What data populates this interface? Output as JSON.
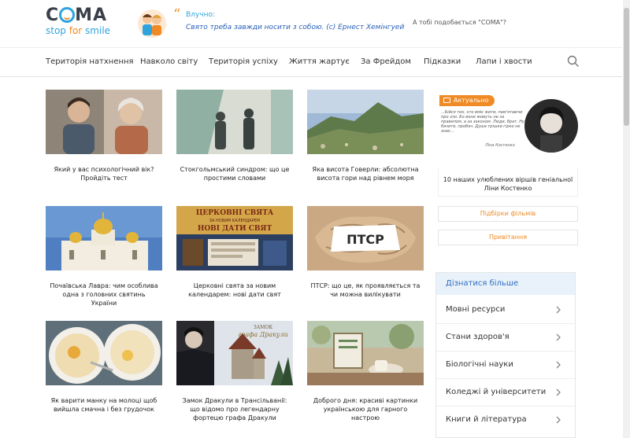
{
  "header": {
    "logo_title_pre": "C",
    "logo_title_post": "MA",
    "logo_sub_1": "stop ",
    "logo_sub_2": "for",
    "logo_sub_3": " smile",
    "quote_label": "Влучно:",
    "quote_text": "Свято треба завжди носити з собою. (с) Ернест Хемінгуей",
    "like_text": "А тобі подобається \"СОМА\"?"
  },
  "nav": {
    "items": [
      "Територія натхнення",
      "Навколо світу",
      "Територія успіху",
      "Життя жартує",
      "За Фрейдом",
      "Підказки",
      "Лапи і хвости"
    ]
  },
  "articles": [
    {
      "title": "Який у вас психологічний вік? Пройдіть тест"
    },
    {
      "title": "Стокгольмський синдром: що це простими словами"
    },
    {
      "title": "Яка висота Говерли: абсолютна висота гори над рівнем моря"
    },
    {
      "title": "Почаївська Лавра: чим особлива одна з головних святинь України"
    },
    {
      "title": "Церковні свята за новим календарем: нові дати свят"
    },
    {
      "title": "ПТСР: що це, як проявляється та чи можна вилікувати"
    },
    {
      "title": "Як варити манку на молоці щоб вийшла смачна і без грудочок"
    },
    {
      "title": "Замок Дракули в Трансільванії: що відомо про легендарну фортецю графа Дракули"
    },
    {
      "title": "Доброго дня: красиві картинки українською для гарного настрою"
    }
  ],
  "thumb_text": {
    "church_line1": "ЦЕРКОВНІ СВЯТА",
    "church_line2": "ЗА НОВИМ КАЛЕНДАРЕМ",
    "church_line3": "НОВІ ДАТИ СВЯТ",
    "ptsr": "ПТСР",
    "dracula_line1": "ЗАМОК",
    "dracula_line2": "графа Дракули"
  },
  "sidebar": {
    "badge": "Актуально",
    "promo_quote": "...Бійся тих, хто вміє жити, пам'ятаючи про зло. Бо вони живуть не за правилом, а за законом. Люди, брат. Ну бачите, пробач. Душа трішки гірко не знає...",
    "promo_author": "Ліна Костенко",
    "link_title": "10 наших улюблених віршів геніальної Ліни Костенко",
    "btn_films": "Підбірки фільмів",
    "btn_greetings": "Привітання",
    "more_title": "Дізнатися більше",
    "more_items": [
      "Мовні ресурси",
      "Стани здоров'я",
      "Біологічні науки",
      "Коледжі й університети",
      "Книги й література"
    ]
  },
  "colors": {
    "brand_blue": "#2fa4dc",
    "brand_orange": "#f08a24",
    "quote_blue": "#2a62b8",
    "more_header_bg": "#e9f1fb"
  }
}
